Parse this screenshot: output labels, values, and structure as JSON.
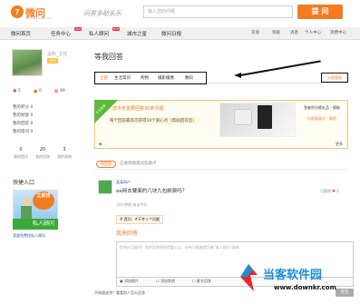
{
  "header": {
    "logo_mark": "?",
    "logo_text": "微问",
    "logo_sub": "wenwen.sogou.com",
    "slogan": "问答多助长乐",
    "search_placeholder": "输入您的问题",
    "ask_button": "提 问"
  },
  "nav": {
    "items": [
      "微问首页",
      "任务中心",
      "私人顾问",
      "城市之星",
      "微问日报"
    ],
    "hot": "HOT",
    "right": [
      "充值",
      "等级",
      "消息",
      "个人中心",
      "消费中心"
    ]
  },
  "sidebar": {
    "username": "温和_主任",
    "level": "主任",
    "stats": [
      "5",
      "0",
      "99"
    ],
    "links": [
      "我的积分",
      "我的财富",
      "我的回答",
      "我的提问"
    ],
    "link_vals": [
      "0",
      "0",
      "0",
      "0"
    ],
    "grid_nums": [
      "0",
      "20",
      "3"
    ],
    "grid_labels": [
      "我的提问",
      "我的回答",
      "我的采纳"
    ],
    "quick_title": "快捷入口",
    "quick_sticker": "立即找",
    "quick_bar": "私人顾问",
    "quick_link": "我要免费找私人顾问"
  },
  "main": {
    "title": "等我回答",
    "tabs": [
      "全部",
      "生活常识",
      "购物",
      "摄影摄像",
      "数码"
    ],
    "manage": "分类管理",
    "promo": {
      "ribbon": "今日任务",
      "line1": "您今天需要回答30条问题",
      "line2": "每个回答最高可获得50个爱心点（帮助回答您）",
      "small": "...",
      "right_title": "答者积分换礼品 - 换取",
      "right_sub": "乐帆城高分 - 美地",
      "more": "更多"
    },
    "status_pill": "待回答",
    "status_other": "已收到围观问答题点",
    "question": {
      "user": "某某网户",
      "text": "ee网去要面的几块九包邮费吗？",
      "meta": "10分钟前  来自手机",
      "reward_label": "可获得",
      "reward_value": "5",
      "ask_label": "# 提问：#不考十个问题"
    },
    "answer": {
      "title": "我来回答",
      "placeholder": "您有好回复吗？您的回答将获得爱心点，还有可能被提问者\"私人顾问\"采纳",
      "tools": [
        "添加图片",
        "添加其他",
        "匿名回答"
      ],
      "submit": "提交",
      "footer": "不知道该答？看看别人怎么回答"
    }
  },
  "watermark": {
    "title": "当客软件园",
    "url": "www.downkr.com"
  },
  "colors": {
    "brand": "#f47c20",
    "nav_bg": "#f0f0f0",
    "link": "#3060a0",
    "watermark": "#1a8fd8"
  }
}
